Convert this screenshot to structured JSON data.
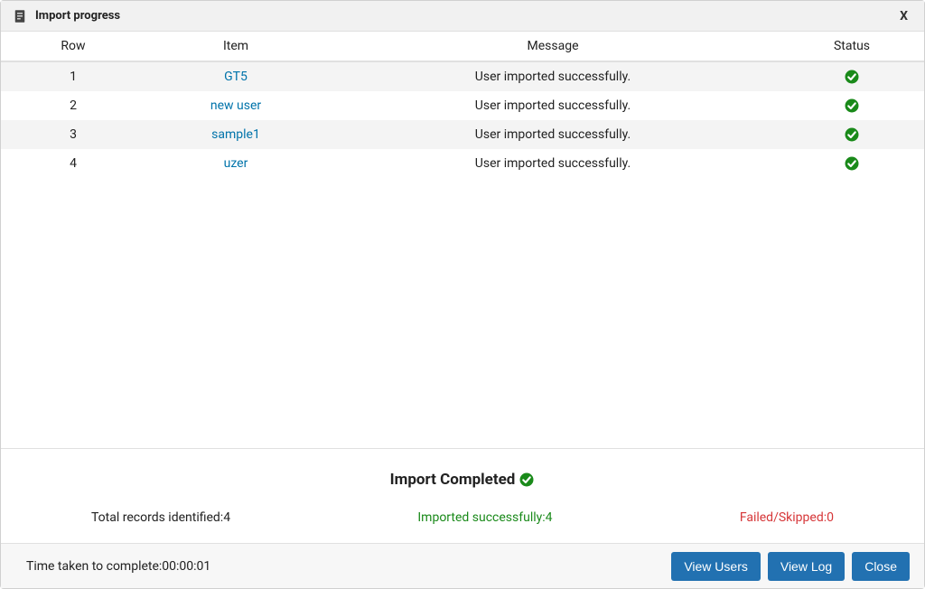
{
  "header": {
    "title": "Import progress",
    "close_label": "X"
  },
  "table": {
    "columns": {
      "row": "Row",
      "item": "Item",
      "message": "Message",
      "status": "Status"
    },
    "rows": [
      {
        "row": "1",
        "item": "GT5",
        "message": "User imported successfully.",
        "status": "success"
      },
      {
        "row": "2",
        "item": "new user",
        "message": "User imported successfully.",
        "status": "success"
      },
      {
        "row": "3",
        "item": "sample1",
        "message": "User imported successfully.",
        "status": "success"
      },
      {
        "row": "4",
        "item": "uzer",
        "message": "User imported successfully.",
        "status": "success"
      }
    ]
  },
  "summary": {
    "title": "Import Completed",
    "total_label": "Total records identified:",
    "total_value": "4",
    "success_label": "Imported successfully:",
    "success_value": "4",
    "failed_label": "Failed/Skipped:",
    "failed_value": "0"
  },
  "footer": {
    "time_label": "Time taken to complete:",
    "time_value": "00:00:01",
    "buttons": {
      "view_users": "View Users",
      "view_log": "View Log",
      "close": "Close"
    }
  },
  "icons": {
    "check_color": "#1a8a1a",
    "doc_color": "#444"
  }
}
